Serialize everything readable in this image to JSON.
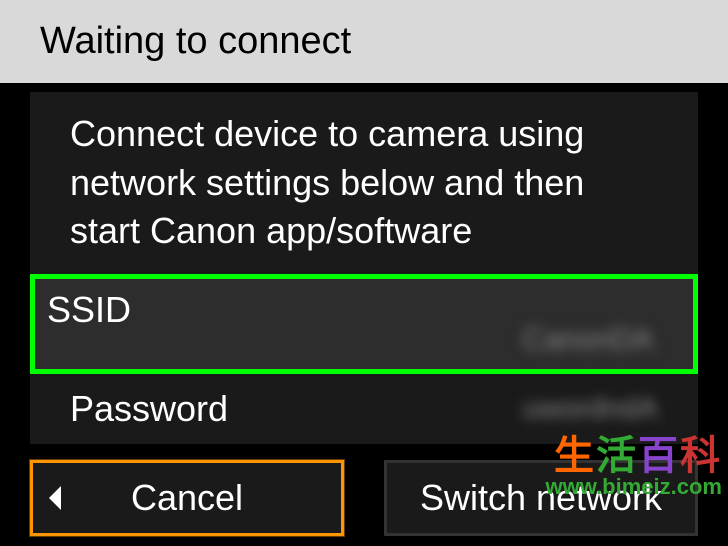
{
  "header": {
    "title": "Waiting to connect"
  },
  "instruction": {
    "text": "Connect device to camera using network settings below and then start Canon app/software"
  },
  "network": {
    "ssid_label": "SSID",
    "ssid_value": "CanonDA",
    "password_label": "Password",
    "password_value": "uwordndA"
  },
  "buttons": {
    "cancel": "Cancel",
    "switch": "Switch network"
  },
  "watermark": {
    "text": "生活百科",
    "url": "www.bimeiz.com"
  }
}
